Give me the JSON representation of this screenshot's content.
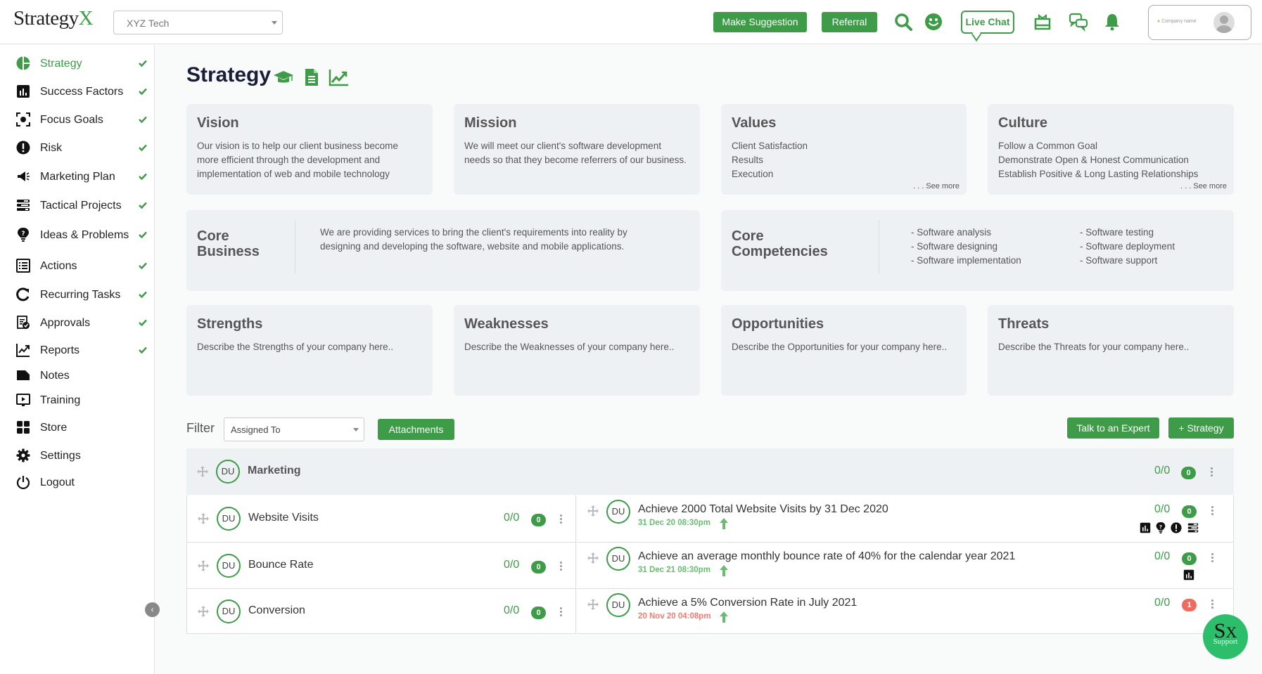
{
  "app": {
    "logo_main": "Strategy",
    "logo_accent": "X"
  },
  "header": {
    "company_select": "XYZ Tech",
    "make_suggestion": "Make Suggestion",
    "referral": "Referral",
    "live_chat": "Live Chat",
    "company_logo_text": "Company name",
    "accent_color": "#3e9b48"
  },
  "sidebar": {
    "items": [
      {
        "label": "Strategy",
        "icon": "pie-chart-icon",
        "checked": true,
        "active": true
      },
      {
        "label": "Success Factors",
        "icon": "bar-chart-icon",
        "checked": true
      },
      {
        "label": "Focus Goals",
        "icon": "focus-target-icon",
        "checked": true
      },
      {
        "label": "Risk",
        "icon": "exclamation-circle-icon",
        "checked": true
      },
      {
        "label": "Marketing Plan",
        "icon": "megaphone-icon",
        "checked": true
      },
      {
        "label": "Tactical Projects",
        "icon": "tasks-list-icon",
        "checked": true
      },
      {
        "label": "Ideas & Problems",
        "icon": "lightbulb-question-icon",
        "checked": true
      },
      {
        "label": "Actions",
        "icon": "checklist-icon",
        "checked": true
      },
      {
        "label": "Recurring Tasks",
        "icon": "refresh-icon",
        "checked": true
      },
      {
        "label": "Approvals",
        "icon": "approval-doc-icon",
        "checked": true
      },
      {
        "label": "Reports",
        "icon": "line-chart-icon",
        "checked": true
      },
      {
        "label": "Notes",
        "icon": "note-icon",
        "checked": false
      },
      {
        "label": "Training",
        "icon": "video-screen-icon",
        "checked": false
      },
      {
        "label": "Store",
        "icon": "grid-icon",
        "checked": false
      },
      {
        "label": "Settings",
        "icon": "gear-icon",
        "checked": false
      },
      {
        "label": "Logout",
        "icon": "power-icon",
        "checked": false
      }
    ]
  },
  "page": {
    "title": "Strategy"
  },
  "cards": {
    "vision": {
      "title": "Vision",
      "body": "Our vision is to help our client business become more efficient through the development and implementation of web and mobile technology"
    },
    "mission": {
      "title": "Mission",
      "body": "We will meet our client's software development needs so that they become referrers of our business."
    },
    "values": {
      "title": "Values",
      "lines": [
        "Client Satisfaction",
        "Results",
        "Execution"
      ],
      "see_more": ". . . See more"
    },
    "culture": {
      "title": "Culture",
      "lines": [
        "Follow a Common Goal",
        "Demonstrate Open & Honest Communication",
        "Establish Positive & Long Lasting Relationships"
      ],
      "see_more": ". . . See more"
    },
    "core_business": {
      "title_line1": "Core",
      "title_line2": "Business",
      "body": "We are providing services to bring the client's requirements into reality by designing and developing the software, website and mobile applications."
    },
    "core_competencies": {
      "title_line1": "Core",
      "title_line2": "Competencies",
      "col1": [
        "- Software analysis",
        "- Software designing",
        "- Software implementation"
      ],
      "col2": [
        "- Software testing",
        "- Software deployment",
        "- Software support"
      ]
    },
    "strengths": {
      "title": "Strengths",
      "body": "Describe the Strengths of your company here.."
    },
    "weaknesses": {
      "title": "Weaknesses",
      "body": "Describe the Weaknesses of your company here.."
    },
    "opportunities": {
      "title": "Opportunities",
      "body": "Describe the Opportunities for your company here.."
    },
    "threats": {
      "title": "Threats",
      "body": "Describe the Threats for your company here.."
    }
  },
  "filter": {
    "label": "Filter",
    "select_value": "Assigned To",
    "attachments": "Attachments",
    "talk_to_expert": "Talk to an Expert",
    "add_strategy": "+ Strategy"
  },
  "goals": {
    "group": {
      "avatar": "DU",
      "title": "Marketing",
      "ratio": "0/0",
      "count": "0"
    },
    "rows": [
      {
        "factor": {
          "avatar": "DU",
          "title": "Website Visits",
          "ratio": "0/0",
          "count": "0"
        },
        "goal": {
          "avatar": "DU",
          "title": "Achieve 2000 Total Website Visits by 31 Dec 2020",
          "due": "31 Dec 20 08:30pm",
          "due_status": "on-track",
          "ratio": "0/0",
          "count": "0",
          "count_status": "green",
          "linked_icons": [
            "bar-chart-icon",
            "lightbulb-question-icon",
            "exclamation-circle-icon",
            "tasks-list-icon"
          ]
        }
      },
      {
        "factor": {
          "avatar": "DU",
          "title": "Bounce Rate",
          "ratio": "0/0",
          "count": "0"
        },
        "goal": {
          "avatar": "DU",
          "title": "Achieve an average monthly bounce rate of 40% for the calendar year 2021",
          "due": "31 Dec 21 08:30pm",
          "due_status": "on-track",
          "ratio": "0/0",
          "count": "0",
          "count_status": "green",
          "linked_icons": [
            "bar-chart-icon"
          ]
        }
      },
      {
        "factor": {
          "avatar": "DU",
          "title": "Conversion",
          "ratio": "0/0",
          "count": "0"
        },
        "goal": {
          "avatar": "DU",
          "title": "Achieve a 5% Conversion Rate in July 2021",
          "due": "20 Nov 20 04:08pm",
          "due_status": "overdue",
          "ratio": "0/0",
          "count": "1",
          "count_status": "red",
          "linked_icons": []
        }
      }
    ]
  },
  "support": {
    "logo_s": "S",
    "logo_x": "X",
    "label": "Support"
  }
}
